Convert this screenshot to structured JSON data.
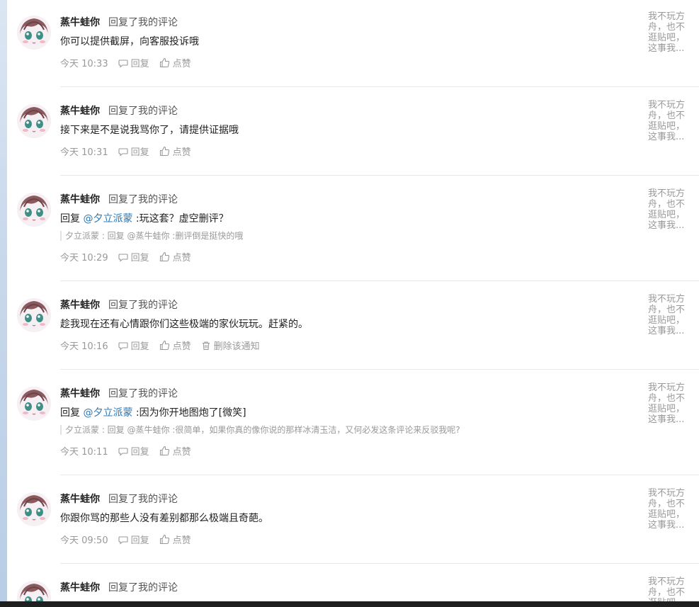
{
  "notifications": [
    {
      "username": "蒸牛蛙你",
      "action": "回复了我的评论",
      "content_prefix": "你可以提供截屏，向客服投诉哦",
      "mention": "",
      "content_suffix": "",
      "quote": "",
      "time": "今天 10:33",
      "reply_label": "回复",
      "like_label": "点赞",
      "delete_label": "",
      "side_post": "我不玩方舟，也不逛贴吧，这事我..."
    },
    {
      "username": "蒸牛蛙你",
      "action": "回复了我的评论",
      "content_prefix": "接下来是不是说我骂你了，请提供证据哦",
      "mention": "",
      "content_suffix": "",
      "quote": "",
      "time": "今天 10:31",
      "reply_label": "回复",
      "like_label": "点赞",
      "delete_label": "",
      "side_post": "我不玩方舟，也不逛贴吧，这事我..."
    },
    {
      "username": "蒸牛蛙你",
      "action": "回复了我的评论",
      "content_prefix": "回复 ",
      "mention": "@夕立派蒙",
      "content_suffix": " :玩这套？虚空删评？",
      "quote": "夕立派蒙 : 回复 @蒸牛蛙你 :删评倒是挺快的哦",
      "time": "今天 10:29",
      "reply_label": "回复",
      "like_label": "点赞",
      "delete_label": "",
      "side_post": "我不玩方舟，也不逛贴吧，这事我..."
    },
    {
      "username": "蒸牛蛙你",
      "action": "回复了我的评论",
      "content_prefix": "趁我现在还有心情跟你们这些极端的家伙玩玩。赶紧的。",
      "mention": "",
      "content_suffix": "",
      "quote": "",
      "time": "今天 10:16",
      "reply_label": "回复",
      "like_label": "点赞",
      "delete_label": "删除该通知",
      "side_post": "我不玩方舟，也不逛贴吧，这事我..."
    },
    {
      "username": "蒸牛蛙你",
      "action": "回复了我的评论",
      "content_prefix": "回复 ",
      "mention": "@夕立派蒙",
      "content_suffix": " :因为你开地图炮了[微笑]",
      "quote": "夕立派蒙 : 回复 @蒸牛蛙你 :很简单，如果你真的像你说的那样冰清玉洁，又何必发这条评论来反驳我呢?",
      "time": "今天 10:11",
      "reply_label": "回复",
      "like_label": "点赞",
      "delete_label": "",
      "side_post": "我不玩方舟，也不逛贴吧，这事我..."
    },
    {
      "username": "蒸牛蛙你",
      "action": "回复了我的评论",
      "content_prefix": "你跟你骂的那些人没有差别都那么极端且奇葩。",
      "mention": "",
      "content_suffix": "",
      "quote": "",
      "time": "今天 09:50",
      "reply_label": "回复",
      "like_label": "点赞",
      "delete_label": "",
      "side_post": "我不玩方舟，也不逛贴吧，这事我..."
    },
    {
      "username": "蒸牛蛙你",
      "action": "回复了我的评论",
      "content_prefix": "",
      "mention": "",
      "content_suffix": "",
      "quote": "",
      "time": "",
      "reply_label": "",
      "like_label": "",
      "delete_label": "",
      "side_post": "我不玩方舟，也不逛贴吧，这事我..."
    }
  ],
  "colors": {
    "mention": "#2a78b8",
    "meta": "#999999",
    "divider": "#e8e8e8"
  },
  "icons": {
    "reply": "comment-bubble-icon",
    "like": "thumbs-up-icon",
    "delete": "trash-icon"
  }
}
